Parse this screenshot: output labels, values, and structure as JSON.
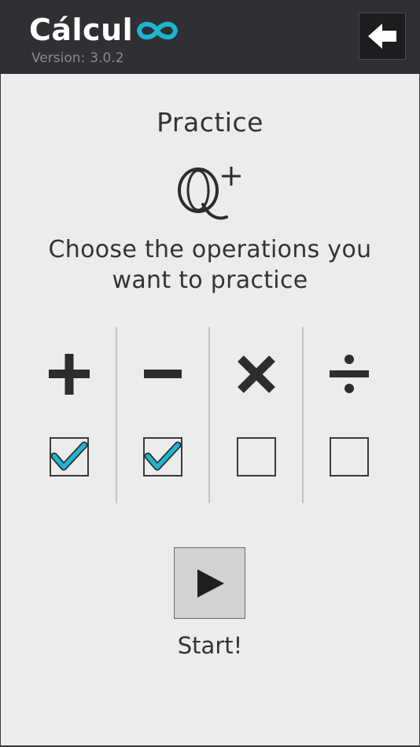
{
  "app": {
    "name_prefix": "Cálcul",
    "logo_icon": "infinity-loop-icon",
    "version_label": "Version:",
    "version_value": "3.0.2",
    "back_icon": "arrow-left-icon"
  },
  "colors": {
    "header_bg": "#2f3033",
    "accent": "#1fb5cf",
    "page_bg": "#ececec",
    "text": "#333333"
  },
  "main": {
    "title": "Practice",
    "logo_icon": "q-plus-icon",
    "instructions_line1": "Choose the operations you",
    "instructions_line2": "want to practice",
    "operations": [
      {
        "symbol": "+",
        "icon": "plus-icon",
        "checked": true
      },
      {
        "symbol": "−",
        "icon": "minus-icon",
        "checked": true
      },
      {
        "symbol": "×",
        "icon": "multiply-icon",
        "checked": false
      },
      {
        "symbol": "÷",
        "icon": "divide-icon",
        "checked": false
      }
    ],
    "start_icon": "play-icon",
    "start_label": "Start!"
  }
}
